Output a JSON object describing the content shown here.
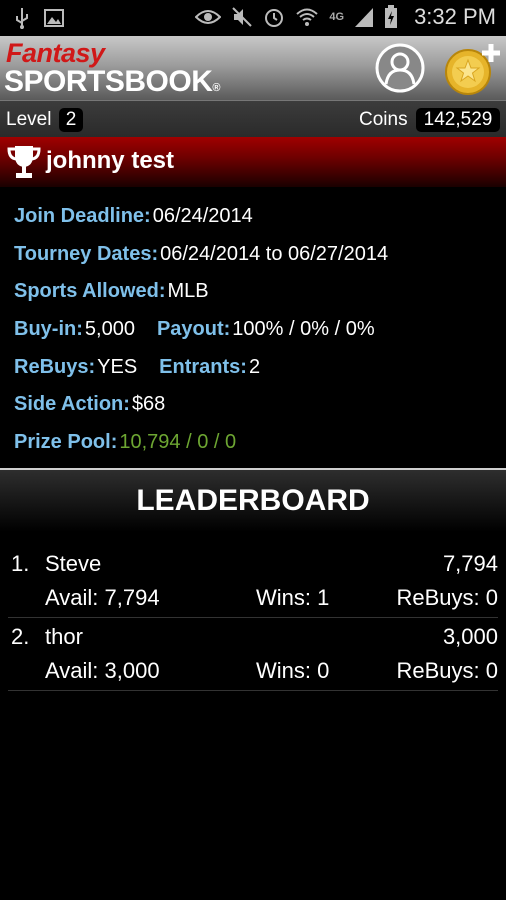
{
  "status_bar": {
    "time": "3:32 PM",
    "network": "4G"
  },
  "app": {
    "logo_top": "Fantasy",
    "logo_bottom": "SPORTSBOOK",
    "logo_reg": "®"
  },
  "level_bar": {
    "level_label": "Level",
    "level_value": "2",
    "coins_label": "Coins",
    "coins_value": "142,529"
  },
  "tourney": {
    "name": "johnny test",
    "join_deadline_label": "Join Deadline:",
    "join_deadline": "06/24/2014",
    "dates_label": "Tourney Dates:",
    "dates": "06/24/2014 to 06/27/2014",
    "sports_label": "Sports Allowed:",
    "sports": "MLB",
    "buyin_label": "Buy-in:",
    "buyin": "5,000",
    "payout_label": "Payout:",
    "payout": "100% / 0% / 0%",
    "rebuys_label": "ReBuys:",
    "rebuys": "YES",
    "entrants_label": "Entrants:",
    "entrants": "2",
    "side_action_label": "Side Action:",
    "side_action": "$68",
    "prize_pool_label": "Prize Pool:",
    "prize_pool": "10,794 / 0 / 0"
  },
  "leaderboard": {
    "title": "LEADERBOARD",
    "rows": [
      {
        "rank": "1.",
        "name": "Steve",
        "score": "7,794",
        "avail": "Avail: 7,794",
        "wins": "Wins: 1",
        "rebuys": "ReBuys: 0"
      },
      {
        "rank": "2.",
        "name": "thor",
        "score": "3,000",
        "avail": "Avail: 3,000",
        "wins": "Wins: 0",
        "rebuys": "ReBuys: 0"
      }
    ]
  }
}
